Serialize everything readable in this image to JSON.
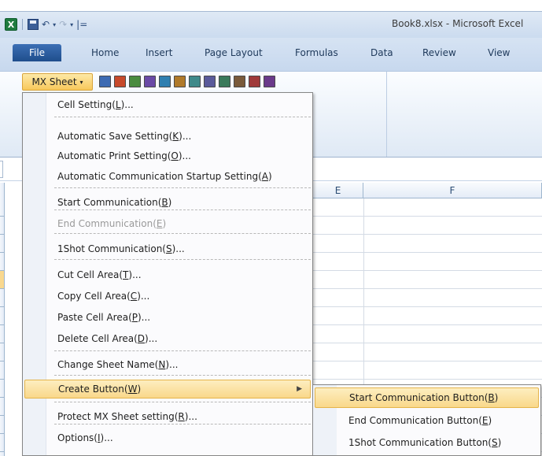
{
  "window": {
    "title": "Book8.xlsx - Microsoft Excel",
    "app_logo": "X",
    "quick_access": {
      "save_icon": "save-icon",
      "undo_glyph": "↶",
      "redo_glyph": "↷",
      "dropdown_glyph": "▾",
      "customize_glyph": "|="
    }
  },
  "ribbon": {
    "tabs": [
      "File",
      "Home",
      "Insert",
      "Page Layout",
      "Formulas",
      "Data",
      "Review",
      "View"
    ],
    "mx_sheet_label": "MX Sheet",
    "mx_sheet_caret": "▾",
    "icon_colors": [
      "#3d6bb3",
      "#c74a2b",
      "#4a8c3f",
      "#6a4aa6",
      "#2f7fb0",
      "#b07a2a",
      "#3f8a8a",
      "#5a5a9a",
      "#3a7a5a",
      "#7a5a3a",
      "#a03a3a",
      "#6a3a8a"
    ]
  },
  "grid": {
    "columns": [
      "E",
      "F"
    ]
  },
  "menu": {
    "items": [
      {
        "label": "Cell Setting(",
        "key": "L",
        "suffix": ")...",
        "disabled": false
      },
      {
        "label": "Automatic Save Setting(",
        "key": "K",
        "suffix": ")...",
        "disabled": false
      },
      {
        "label": "Automatic Print Setting(",
        "key": "O",
        "suffix": ")...",
        "disabled": false
      },
      {
        "label": "Automatic Communication Startup Setting(",
        "key": "A",
        "suffix": ")",
        "disabled": false
      },
      {
        "label": "Start Communication(",
        "key": "B",
        "suffix": ")",
        "disabled": false
      },
      {
        "label": "End Communication(",
        "key": "E",
        "suffix": ")",
        "disabled": true
      },
      {
        "label": "1Shot Communication(",
        "key": "S",
        "suffix": ")...",
        "disabled": false
      },
      {
        "label": "Cut Cell Area(",
        "key": "T",
        "suffix": ")...",
        "disabled": false
      },
      {
        "label": "Copy Cell Area(",
        "key": "C",
        "suffix": ")...",
        "disabled": false
      },
      {
        "label": "Paste Cell Area(",
        "key": "P",
        "suffix": ")...",
        "disabled": false
      },
      {
        "label": "Delete Cell Area(",
        "key": "D",
        "suffix": ")...",
        "disabled": false
      },
      {
        "label": "Change Sheet Name(",
        "key": "N",
        "suffix": ")...",
        "disabled": false
      },
      {
        "label": "Create Button(",
        "key": "W",
        "suffix": ")",
        "disabled": false,
        "has_submenu": true,
        "submenu_arrow": "▶"
      },
      {
        "label": "Protect MX Sheet setting(",
        "key": "R",
        "suffix": ")...",
        "disabled": false
      },
      {
        "label": "Options(",
        "key": "I",
        "suffix": ")...",
        "disabled": false
      }
    ]
  },
  "submenu": {
    "items": [
      {
        "label": "Start Communication Button(",
        "key": "B",
        "suffix": ")"
      },
      {
        "label": "End Communication Button(",
        "key": "E",
        "suffix": ")"
      },
      {
        "label": "1Shot Communication Button(",
        "key": "S",
        "suffix": ")"
      }
    ]
  }
}
